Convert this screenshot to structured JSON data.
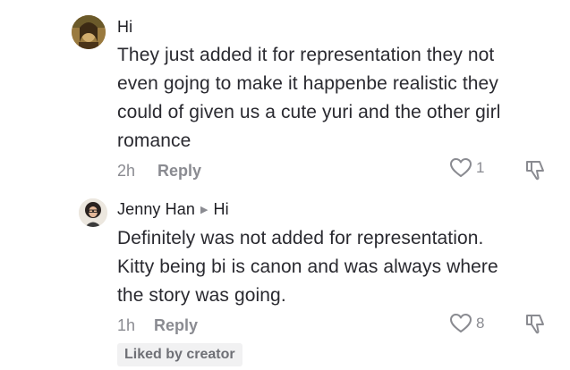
{
  "comments": [
    {
      "author": "Hi",
      "text_lines": [
        "They just added it for representation they not",
        "even gojng to make it happenbe realistic they",
        "could of given us a cute yuri and the other girl",
        "romance"
      ],
      "time": "2h",
      "reply_label": "Reply",
      "like_count": "1",
      "like_icon": "heart-outline-icon",
      "dislike_icon": "thumbs-down-icon"
    },
    {
      "author": "Jenny Han",
      "reply_to": "Hi",
      "reply_to_icon": "right-triangle-icon",
      "text_lines": [
        "Definitely was not added for representation.",
        "Kitty being bi is canon and was always where",
        "the story was going."
      ],
      "time": "1h",
      "reply_label": "Reply",
      "like_count": "8",
      "like_icon": "heart-outline-icon",
      "dislike_icon": "thumbs-down-icon",
      "badge": "Liked by creator"
    }
  ],
  "colors": {
    "muted": "#8a8b91",
    "text": "#2a2a30",
    "badge_bg": "#f1f1f2"
  }
}
